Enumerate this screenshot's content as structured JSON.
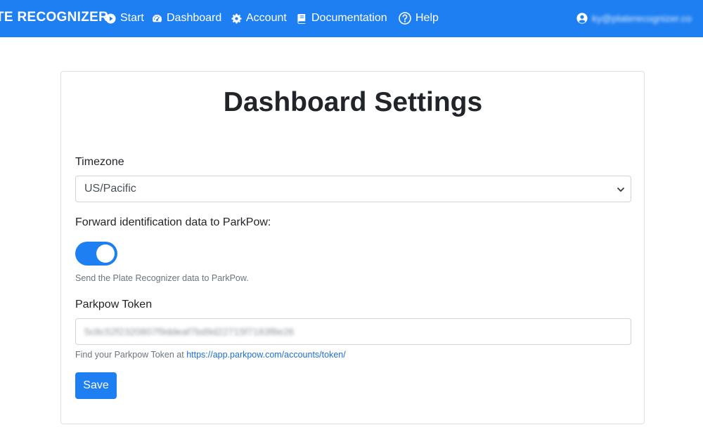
{
  "navbar": {
    "brand": "TE RECOGNIZER",
    "items": [
      {
        "label": "Start",
        "icon": "play-circle-icon"
      },
      {
        "label": "Dashboard",
        "icon": "tachometer-icon"
      },
      {
        "label": "Account",
        "icon": "gear-icon"
      },
      {
        "label": "Documentation",
        "icon": "book-icon"
      },
      {
        "label": "Help",
        "icon": "question-circle-icon"
      }
    ],
    "user": {
      "icon": "user-circle-icon",
      "email": "ky@platerecognizer.co"
    },
    "background_color": "#1e7ff2"
  },
  "page": {
    "title": "Dashboard Settings"
  },
  "form": {
    "timezone": {
      "label": "Timezone",
      "selected": "US/Pacific"
    },
    "forward": {
      "label": "Forward identification data to ParkPow:",
      "enabled": true,
      "help": "Send the Plate Recognizer data to ParkPow."
    },
    "token": {
      "label": "Parkpow Token",
      "value": "5c8c52f2320807f9ddeaf7bd9d22715f7183f8e26",
      "help_prefix": "Find your Parkpow Token at ",
      "help_link": "https://app.parkpow.com/accounts/token/"
    },
    "save_label": "Save"
  },
  "colors": {
    "accent": "#1e7ff2",
    "help_text": "#6c757d",
    "border": "#ced4da"
  }
}
